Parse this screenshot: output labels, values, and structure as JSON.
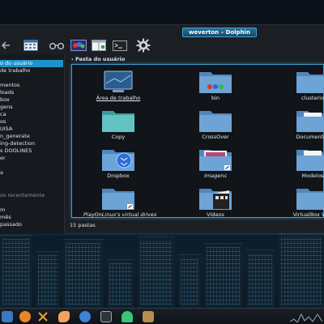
{
  "window": {
    "title": "weverton – Dolphin"
  },
  "toolbar": {
    "items": [
      "back-icon",
      "icons-view-icon",
      "compact-view-icon",
      "preview-icon",
      "split-view-icon",
      "terminal-icon",
      "settings-icon"
    ]
  },
  "sidebar": {
    "items": [
      {
        "label": "o do usuário",
        "selected": true
      },
      {
        "label": "de trabalho"
      },
      {
        "label": ""
      },
      {
        "label": "mentos"
      },
      {
        "label": "loads"
      },
      {
        "label": "box"
      },
      {
        "label": "gens"
      },
      {
        "label": "ca"
      },
      {
        "label": "os"
      },
      {
        "label": "UISA"
      },
      {
        "label": "n_generate"
      },
      {
        "label": "ing-detection"
      },
      {
        "label": "s DOOLINES"
      },
      {
        "label": "er"
      },
      {
        "label": ""
      },
      {
        "label": "a"
      },
      {
        "label": ""
      },
      {
        "label": "os recentemente",
        "muted": true
      },
      {
        "label": ""
      },
      {
        "label": "m"
      },
      {
        "label": "mês"
      },
      {
        "label": "passado"
      }
    ]
  },
  "breadcrumb": {
    "label": "Pasta do usuário"
  },
  "files": [
    {
      "name": "Área de trabalho",
      "style": "underline",
      "icon": "desktop-folder-icon"
    },
    {
      "name": "bin",
      "icon": "bin-folder-icon"
    },
    {
      "name": "clusterio",
      "icon": "folder-icon"
    },
    {
      "name": "Copy",
      "icon": "copy-folder-icon"
    },
    {
      "name": "CrossOver",
      "icon": "folder-icon"
    },
    {
      "name": "Documentos",
      "icon": "documents-folder-icon"
    },
    {
      "name": "Dropbox",
      "icon": "dropbox-folder-icon"
    },
    {
      "name": "Imagens",
      "style": "italic",
      "icon": "pictures-link-icon"
    },
    {
      "name": "Modelos",
      "icon": "templates-folder-icon"
    },
    {
      "name": "PlayOnLinux's virtual drives",
      "style": "italic",
      "icon": "link-folder-icon"
    },
    {
      "name": "Vídeos",
      "icon": "videos-folder-icon"
    },
    {
      "name": "VirtualBox VMs",
      "icon": "folder-icon"
    }
  ],
  "status": {
    "label": "15 pastas"
  },
  "taskbar": {
    "items": [
      "kde-menu-icon",
      "files-icon",
      "firefox-icon",
      "tools-icon",
      "fish-icon",
      "kde-connect-icon",
      "terminal-icon",
      "pacman-ghost-icon",
      "package-icon"
    ]
  },
  "colors": {
    "accent": "#1e93c9",
    "folder": "#6ea3d6",
    "window": "#1b1f24"
  }
}
